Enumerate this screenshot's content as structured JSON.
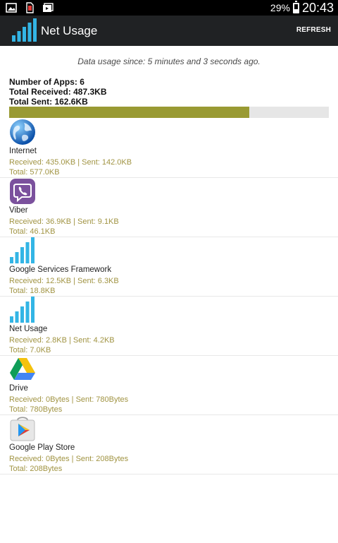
{
  "statusbar": {
    "battery": "29%",
    "battery_level": 0.29,
    "time": "20:43",
    "icons": [
      "image-icon",
      "sim-alert-icon",
      "media-icon"
    ]
  },
  "appbar": {
    "title": "Net Usage",
    "refresh_label": "REFRESH"
  },
  "since_text": "Data usage since: 5 minutes and 3 seconds ago.",
  "summary": {
    "apps_line": "Number of Apps: 6",
    "received_line": "Total Received: 487.3KB",
    "sent_line": "Total Sent: 162.6KB",
    "received_share": 0.75
  },
  "apps": [
    {
      "name": "Internet",
      "rs": "Received: 435.0KB | Sent: 142.0KB",
      "total": "Total: 577.0KB",
      "icon": "globe-icon"
    },
    {
      "name": "Viber",
      "rs": "Received: 36.9KB | Sent: 9.1KB",
      "total": "Total: 46.1KB",
      "icon": "viber-icon"
    },
    {
      "name": "Google Services Framework",
      "rs": "Received: 12.5KB | Sent: 6.3KB",
      "total": "Total: 18.8KB",
      "icon": "signal-bars-icon"
    },
    {
      "name": "Net Usage",
      "rs": "Received: 2.8KB | Sent: 4.2KB",
      "total": "Total: 7.0KB",
      "icon": "signal-bars-icon"
    },
    {
      "name": "Drive",
      "rs": "Received: 0Bytes | Sent: 780Bytes",
      "total": "Total: 780Bytes",
      "icon": "drive-icon"
    },
    {
      "name": "Google Play Store",
      "rs": "Received: 0Bytes | Sent: 208Bytes",
      "total": "Total: 208Bytes",
      "icon": "play-store-icon"
    }
  ],
  "colors": {
    "appbar": "#202224",
    "bar_fill": "#999a33",
    "detail_text": "#a19443",
    "icon_blue": "#33b5e5"
  }
}
